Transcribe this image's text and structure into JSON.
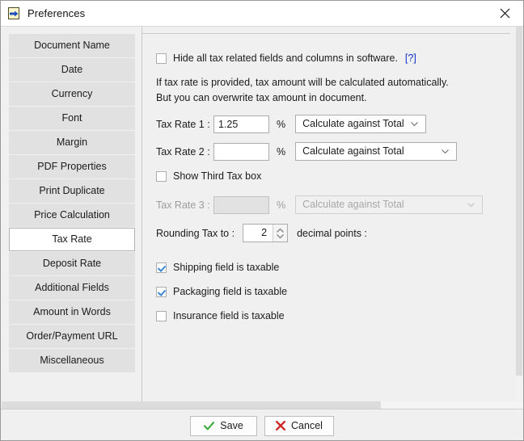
{
  "window": {
    "title": "Preferences",
    "icon": "export-document-icon",
    "close_label": "✕"
  },
  "sidebar": {
    "items": [
      {
        "label": "Document Name",
        "selected": false
      },
      {
        "label": "Date",
        "selected": false
      },
      {
        "label": "Currency",
        "selected": false
      },
      {
        "label": "Font",
        "selected": false
      },
      {
        "label": "Margin",
        "selected": false
      },
      {
        "label": "PDF Properties",
        "selected": false
      },
      {
        "label": "Print Duplicate",
        "selected": false
      },
      {
        "label": "Price Calculation",
        "selected": false
      },
      {
        "label": "Tax Rate",
        "selected": true
      },
      {
        "label": "Deposit Rate",
        "selected": false
      },
      {
        "label": "Additional Fields",
        "selected": false
      },
      {
        "label": "Amount in Words",
        "selected": false
      },
      {
        "label": "Order/Payment URL",
        "selected": false
      },
      {
        "label": "Miscellaneous",
        "selected": false
      }
    ]
  },
  "panel": {
    "hide_tax_checkbox": {
      "label": "Hide all tax related fields and columns in software.",
      "checked": false,
      "help_link": "[?]"
    },
    "hint_line1": "If tax rate is provided, tax amount will be calculated automatically.",
    "hint_line2": "But you can overwrite tax amount in document.",
    "tax_rate_1": {
      "label": "Tax Rate 1 :",
      "value": "1.25",
      "unit": "%",
      "mode": "Calculate against Total",
      "disabled": false
    },
    "tax_rate_2": {
      "label": "Tax Rate 2 :",
      "value": "",
      "unit": "%",
      "mode": "Calculate against Total",
      "disabled": false
    },
    "show_third_tax": {
      "label": "Show Third Tax box",
      "checked": false
    },
    "tax_rate_3": {
      "label": "Tax Rate 3 :",
      "value": "",
      "unit": "%",
      "mode": "Calculate against Total",
      "disabled": true
    },
    "rounding": {
      "label": "Rounding Tax to  :",
      "value": "2",
      "suffix": "decimal points :"
    },
    "taxable_options": [
      {
        "label": "Shipping field is taxable",
        "checked": true
      },
      {
        "label": "Packaging field is taxable",
        "checked": true
      },
      {
        "label": "Insurance field is taxable",
        "checked": false
      }
    ]
  },
  "footer": {
    "save_label": "Save",
    "cancel_label": "Cancel"
  },
  "colors": {
    "accent_link": "#1030d0",
    "check_blue": "#3a87d8",
    "save_green": "#3faa3f",
    "cancel_red": "#cc2222"
  }
}
